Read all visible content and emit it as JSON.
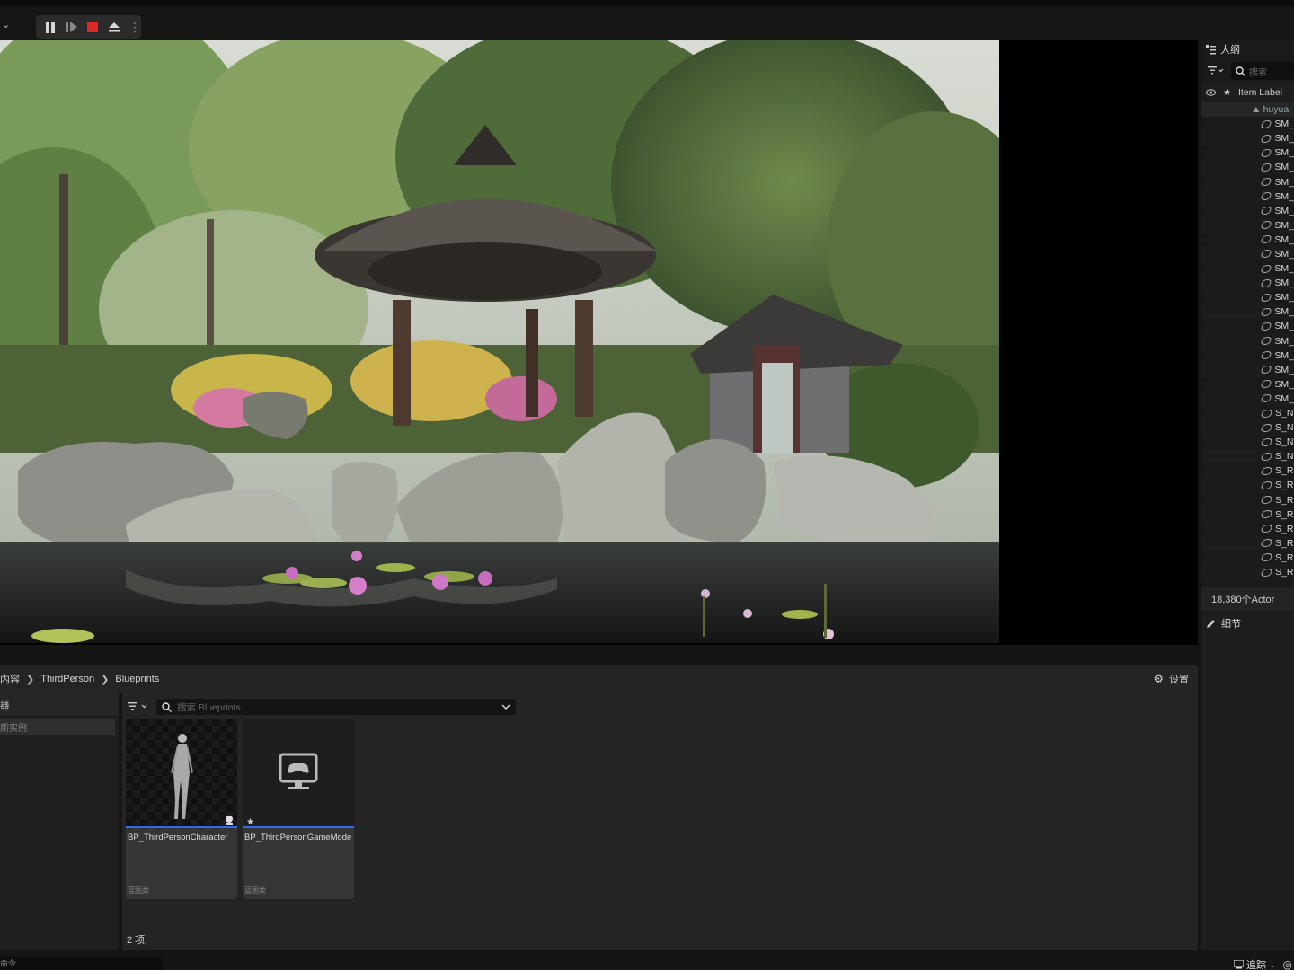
{
  "toolbar": {
    "chevron": "⌄",
    "kebab": "⋮"
  },
  "outliner": {
    "title": "大纲",
    "search_placeholder": "搜索...",
    "column_label": "Item Label",
    "folder_name": "huyua",
    "items": [
      "SM_",
      "SM_",
      "SM_",
      "SM_",
      "SM_",
      "SM_",
      "SM_",
      "SM_",
      "SM_",
      "SM_",
      "SM_",
      "SM_",
      "SM_",
      "SM_",
      "SM_",
      "SM_",
      "SM_",
      "SM_",
      "SM_",
      "SM_",
      "S_N",
      "S_N",
      "S_N",
      "S_N",
      "S_R",
      "S_R",
      "S_R",
      "S_R",
      "S_R",
      "S_R",
      "S_R",
      "S_R"
    ],
    "actor_count": "18,380个Actor"
  },
  "details": {
    "title": "细节"
  },
  "content_browser": {
    "breadcrumb": [
      "内容",
      "ThirdPerson",
      "Blueprints"
    ],
    "settings_label": "设置",
    "left_header": "器",
    "left_item": "质实例",
    "search_placeholder": "搜索 Blueprints",
    "assets": [
      {
        "name": "BP_ThirdPersonCharacter",
        "type": "蓝图类"
      },
      {
        "name": "BP_ThirdPersonGameMode",
        "type": "蓝图类"
      }
    ],
    "item_count": "2 项"
  },
  "statusbar": {
    "cmd_placeholder": "命令",
    "trace_label": "追踪"
  },
  "colors": {
    "accent": "#2d6be8",
    "stop": "#e0282b",
    "panel": "#242424"
  }
}
